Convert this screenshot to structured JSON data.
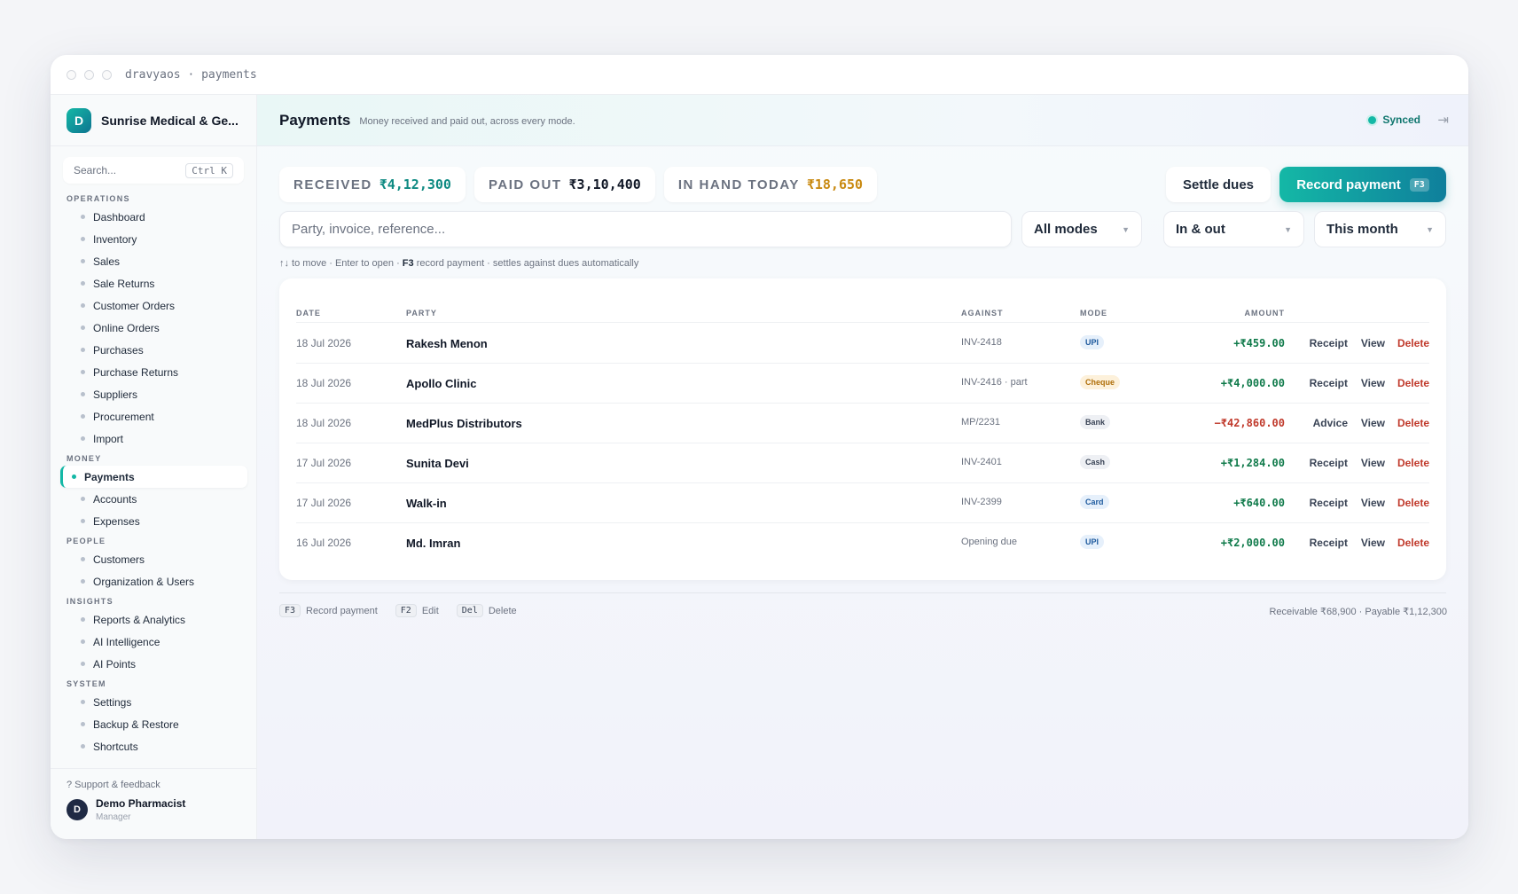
{
  "window": {
    "title": "dravyaos · payments"
  },
  "brand": {
    "initial": "D",
    "name": "Sunrise Medical & Ge..."
  },
  "search": {
    "placeholder": "Search...",
    "shortcut": "Ctrl K"
  },
  "sidebar": {
    "sections": [
      {
        "label": "OPERATIONS",
        "items": [
          "Dashboard",
          "Inventory",
          "Sales",
          "Sale Returns",
          "Customer Orders",
          "Online Orders",
          "Purchases",
          "Purchase Returns",
          "Suppliers",
          "Procurement",
          "Import"
        ]
      },
      {
        "label": "MONEY",
        "items": [
          "Payments",
          "Accounts",
          "Expenses"
        ]
      },
      {
        "label": "PEOPLE",
        "items": [
          "Customers",
          "Organization & Users"
        ]
      },
      {
        "label": "INSIGHTS",
        "items": [
          "Reports & Analytics",
          "AI Intelligence",
          "AI Points"
        ]
      },
      {
        "label": "SYSTEM",
        "items": [
          "Settings",
          "Backup & Restore",
          "Shortcuts"
        ]
      }
    ],
    "active": "Payments",
    "support": "? Support & feedback",
    "user": {
      "initial": "D",
      "name": "Demo Pharmacist",
      "role": "Manager"
    }
  },
  "header": {
    "title": "Payments",
    "subtitle": "Money received and paid out, across every mode.",
    "status": "Synced"
  },
  "stats": {
    "received_label": "RECEIVED",
    "received_value": "₹4,12,300",
    "paid_label": "PAID OUT",
    "paid_value": "₹3,10,400",
    "hand_label": "IN HAND TODAY",
    "hand_value": "₹18,650"
  },
  "actions": {
    "settle": "Settle dues",
    "record": "Record payment",
    "record_key": "F3"
  },
  "filters": {
    "placeholder": "Party, invoice, reference...",
    "mode": "All modes",
    "direction": "In & out",
    "period": "This month"
  },
  "hint": {
    "pre": "↑↓ to move · Enter to open · ",
    "key": "F3",
    "post": " record payment · settles against dues automatically"
  },
  "table": {
    "headers": {
      "date": "DATE",
      "party": "PARTY",
      "against": "AGAINST",
      "mode": "MODE",
      "amount": "AMOUNT"
    },
    "rows": [
      {
        "date": "18 Jul 2026",
        "party": "Rakesh Menon",
        "against": "INV-2418",
        "mode": "UPI",
        "amount": "+₹459.00",
        "doc": "Receipt"
      },
      {
        "date": "18 Jul 2026",
        "party": "Apollo Clinic",
        "against": "INV-2416 · part",
        "mode": "Cheque",
        "amount": "+₹4,000.00",
        "doc": "Receipt"
      },
      {
        "date": "18 Jul 2026",
        "party": "MedPlus Distributors",
        "against": "MP/2231",
        "mode": "Bank",
        "amount": "−₹42,860.00",
        "doc": "Advice"
      },
      {
        "date": "17 Jul 2026",
        "party": "Sunita Devi",
        "against": "INV-2401",
        "mode": "Cash",
        "amount": "+₹1,284.00",
        "doc": "Receipt"
      },
      {
        "date": "17 Jul 2026",
        "party": "Walk-in",
        "against": "INV-2399",
        "mode": "Card",
        "amount": "+₹640.00",
        "doc": "Receipt"
      },
      {
        "date": "16 Jul 2026",
        "party": "Md. Imran",
        "against": "Opening due",
        "mode": "UPI",
        "amount": "+₹2,000.00",
        "doc": "Receipt"
      }
    ],
    "view_label": "View",
    "delete_label": "Delete"
  },
  "footer": {
    "shortcuts": [
      {
        "key": "F3",
        "label": "Record payment"
      },
      {
        "key": "F2",
        "label": "Edit"
      },
      {
        "key": "Del",
        "label": "Delete"
      }
    ],
    "summary": "Receivable ₹68,900 · Payable ₹1,12,300"
  }
}
